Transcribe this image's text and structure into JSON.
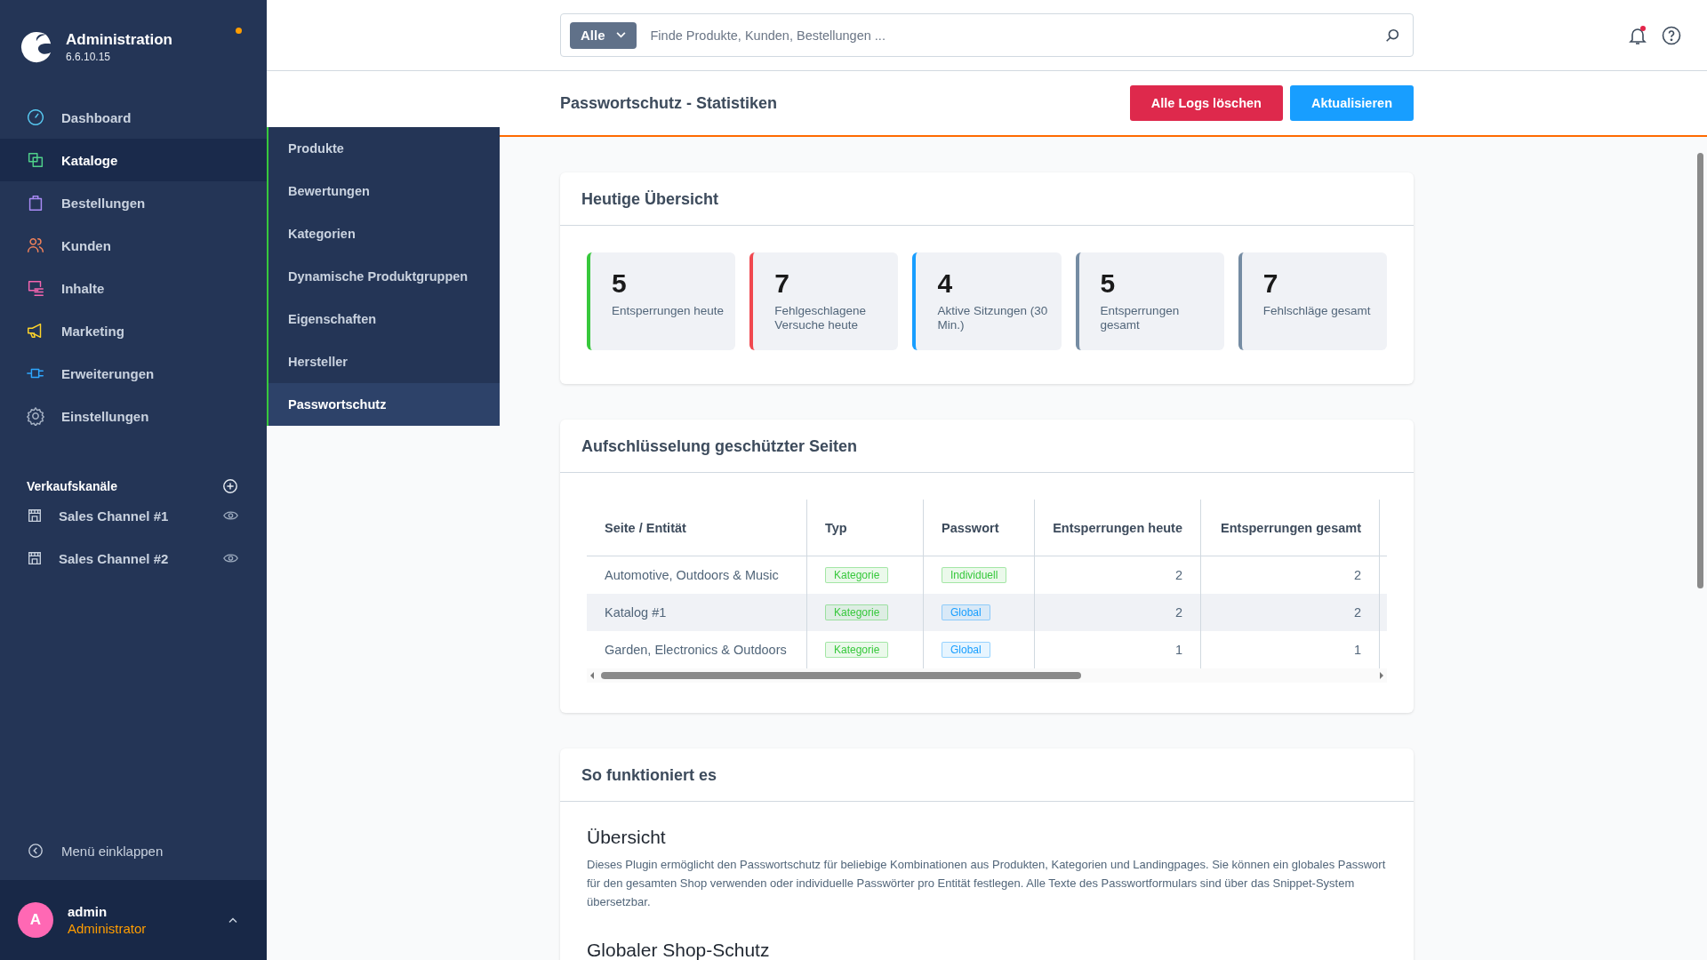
{
  "app": {
    "title": "Administration",
    "version": "6.6.10.15"
  },
  "nav": [
    {
      "label": "Dashboard",
      "selected": false
    },
    {
      "label": "Kataloge",
      "selected": true
    },
    {
      "label": "Bestellungen",
      "selected": false
    },
    {
      "label": "Kunden",
      "selected": false
    },
    {
      "label": "Inhalte",
      "selected": false
    },
    {
      "label": "Marketing",
      "selected": false
    },
    {
      "label": "Erweiterungen",
      "selected": false
    },
    {
      "label": "Einstellungen",
      "selected": false
    }
  ],
  "sales_channels": {
    "title": "Verkaufskanäle",
    "items": [
      {
        "label": "Sales Channel #1"
      },
      {
        "label": "Sales Channel #2"
      }
    ]
  },
  "collapse": "Menü einklappen",
  "user": {
    "initial": "A",
    "name": "admin",
    "role": "Administrator"
  },
  "submenu": [
    {
      "label": "Produkte",
      "selected": false
    },
    {
      "label": "Bewertungen",
      "selected": false
    },
    {
      "label": "Kategorien",
      "selected": false
    },
    {
      "label": "Dynamische Produktgruppen",
      "selected": false
    },
    {
      "label": "Eigenschaften",
      "selected": false
    },
    {
      "label": "Hersteller",
      "selected": false
    },
    {
      "label": "Passwortschutz",
      "selected": true
    }
  ],
  "search": {
    "scope": "Alle",
    "placeholder": "Finde Produkte, Kunden, Bestellungen ..."
  },
  "page": {
    "title": "Passwortschutz - Statistiken",
    "buttons": [
      {
        "label": "Alle Logs löschen",
        "kind": "danger"
      },
      {
        "label": "Aktualisieren",
        "kind": "primary"
      }
    ]
  },
  "overview": {
    "title": "Heutige Übersicht",
    "stats": [
      {
        "value": "5",
        "label": "Entsperrungen heute",
        "color": "#37c83c"
      },
      {
        "value": "7",
        "label": "Fehlgeschlagene Versuche heute",
        "color": "#f0484f"
      },
      {
        "value": "4",
        "label": "Aktive Sitzungen (30 Min.)",
        "color": "#189eff"
      },
      {
        "value": "5",
        "label": "Entsperrungen gesamt",
        "color": "#758ca3"
      },
      {
        "value": "7",
        "label": "Fehlschläge gesamt",
        "color": "#758ca3"
      }
    ]
  },
  "breakdown": {
    "title": "Aufschlüsselung geschützter Seiten",
    "columns": [
      "Seite / Entität",
      "Typ",
      "Passwort",
      "Entsperrungen heute",
      "Entsperrungen gesamt"
    ],
    "rows": [
      {
        "page": "Automotive, Outdoors & Music",
        "type": {
          "text": "Kategorie",
          "color": "#37c83c"
        },
        "password": {
          "text": "Individuell",
          "color": "#37c83c"
        },
        "unlocks_today": "2",
        "unlocks_total": "2",
        "selected": false
      },
      {
        "page": "Katalog #1",
        "type": {
          "text": "Kategorie",
          "color": "#37c83c"
        },
        "password": {
          "text": "Global",
          "color": "#189eff"
        },
        "unlocks_today": "2",
        "unlocks_total": "2",
        "selected": true
      },
      {
        "page": "Garden, Electronics & Outdoors",
        "type": {
          "text": "Kategorie",
          "color": "#37c83c"
        },
        "password": {
          "text": "Global",
          "color": "#189eff"
        },
        "unlocks_today": "1",
        "unlocks_total": "1",
        "selected": false
      }
    ]
  },
  "howto": {
    "title": "So funktioniert es",
    "sections": [
      {
        "heading": "Übersicht",
        "text": "Dieses Plugin ermöglicht den Passwortschutz für beliebige Kombinationen aus Produkten, Kategorien und Landingpages. Sie können ein globales Passwort für den gesamten Shop verwenden oder individuelle Passwörter pro Entität festlegen. Alle Texte des Passwortformulars sind über das Snippet-System übersetzbar."
      },
      {
        "heading": "Globaler Shop-Schutz"
      }
    ]
  }
}
